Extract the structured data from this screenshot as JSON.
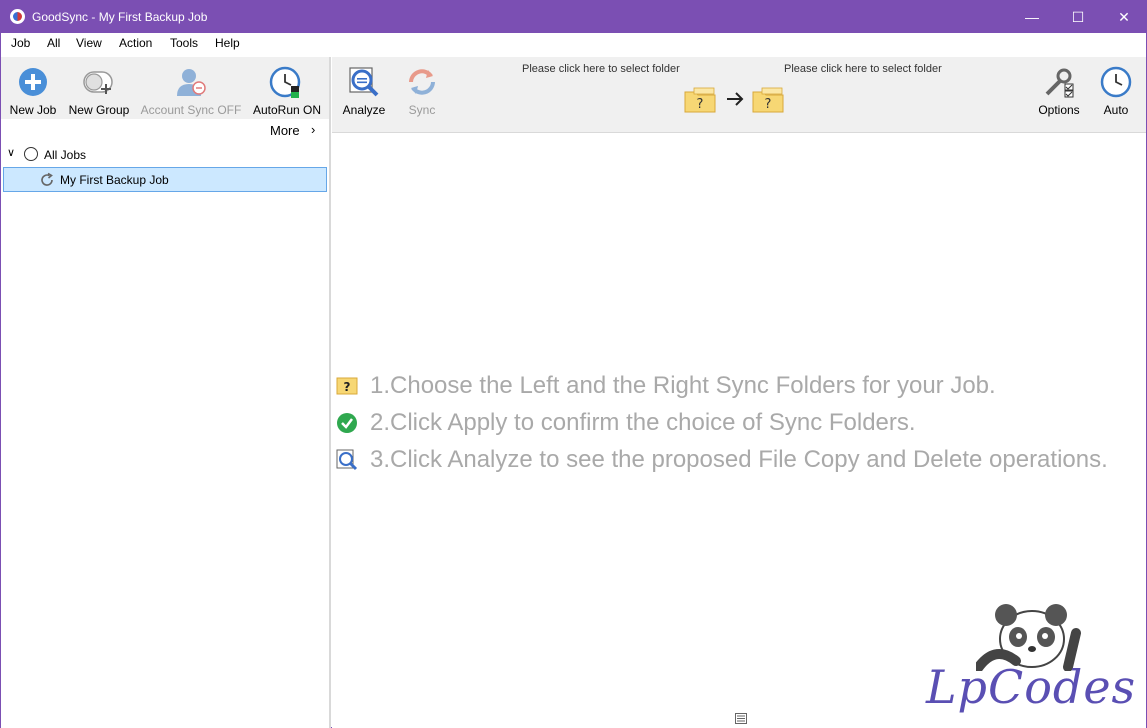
{
  "window": {
    "title": "GoodSync - My First Backup Job",
    "controls": {
      "minimize": "—",
      "maximize": "☐",
      "close": "✕"
    }
  },
  "menu": [
    "Job",
    "All",
    "View",
    "Action",
    "Tools",
    "Help"
  ],
  "left_toolbar": {
    "new_job": "New Job",
    "new_group": "New Group",
    "account_sync": "Account Sync OFF",
    "autorun": "AutoRun ON",
    "more": "More",
    "more_chevron": "›"
  },
  "tree": {
    "root_label": "All Jobs",
    "root_chevron": "∨",
    "items": [
      {
        "label": "My First Backup Job"
      }
    ]
  },
  "right_toolbar": {
    "analyze": "Analyze",
    "sync": "Sync",
    "left_folder_prompt": "Please click here to select folder",
    "right_folder_prompt": "Please click here to select folder",
    "options": "Options",
    "auto": "Auto"
  },
  "instructions": [
    "1.Choose the Left and the Right Sync Folders for your Job.",
    "2.Click Apply to confirm the choice of Sync Folders.",
    "3.Click Analyze to see the proposed File Copy and Delete operations."
  ],
  "watermark": {
    "text": "LpCodes"
  },
  "colors": {
    "titlebar": "#7b4fb3",
    "selection": "#cce8ff",
    "instruction_text": "#a9a9a9",
    "folder_yellow": "#f7d774"
  }
}
